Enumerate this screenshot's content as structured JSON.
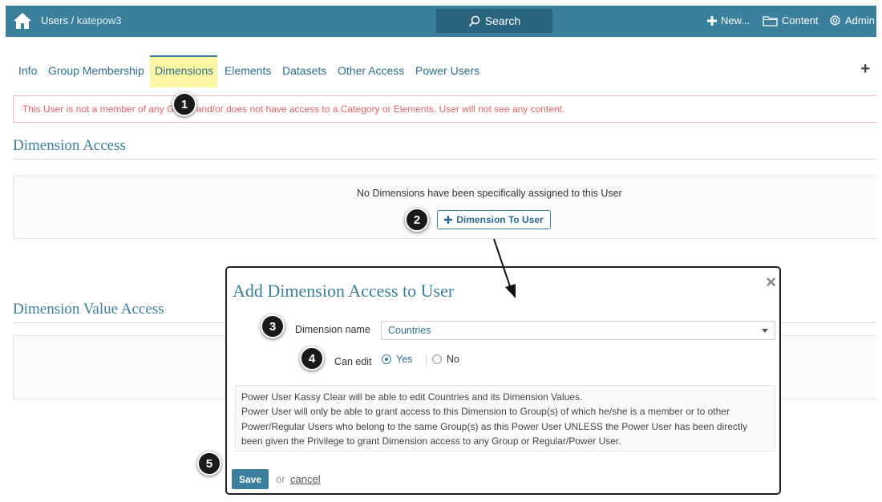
{
  "header": {
    "breadcrumb_root": "Users",
    "breadcrumb_sep": " / ",
    "breadcrumb_user": "katepow3",
    "search_label": "Search",
    "new_label": "New...",
    "content_label": "Content",
    "admin_label": "Admin"
  },
  "tabs": [
    {
      "label": "Info"
    },
    {
      "label": "Group Membership"
    },
    {
      "label": "Dimensions",
      "active": true
    },
    {
      "label": "Elements"
    },
    {
      "label": "Datasets"
    },
    {
      "label": "Other Access"
    },
    {
      "label": "Power Users"
    }
  ],
  "add_tab_label": "+",
  "alert": {
    "text": "This User is not a member of any Group and/or does not have access to a Category or Elements. User will not see any content."
  },
  "dimension_access": {
    "title": "Dimension Access",
    "empty_text": "No Dimensions have been specifically assigned to this User",
    "add_button_label": "Dimension To User"
  },
  "dimension_value_access": {
    "title": "Dimension Value Access"
  },
  "modal": {
    "title": "Add Dimension Access to User",
    "close_label": "×",
    "dimension_name_label": "Dimension name",
    "dimension_name_value": "Countries",
    "can_edit_label": "Can edit",
    "can_edit_yes": "Yes",
    "can_edit_no": "No",
    "can_edit_selected": "Yes",
    "info_line1": "Power User Kassy Clear will be able to edit Countries and its Dimension Values.",
    "info_line2": "Power User will only be able to grant access to this Dimension to Group(s) of which he/she is a member or to other Power/Regular Users who belong to the same Group(s) as this Power User UNLESS the Power User has been directly been given the Privilege to grant Dimension access to any Group or Regular/Power User.",
    "save_label": "Save",
    "or_label": "or",
    "cancel_label": "cancel"
  },
  "markers": [
    "1",
    "2",
    "3",
    "4",
    "5"
  ],
  "colors": {
    "brand": "#3a7f9b",
    "active_tab_bg": "#fdf6a3",
    "alert_text": "#e06464"
  }
}
